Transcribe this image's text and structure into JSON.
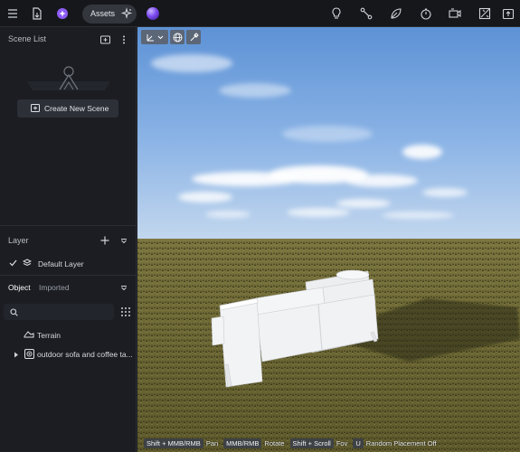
{
  "topbar": {
    "assets_label": "Assets"
  },
  "scene_list": {
    "title": "Scene List",
    "create_button_label": "Create New Scene"
  },
  "layer": {
    "title": "Layer",
    "default_layer_label": "Default Layer"
  },
  "object_panel": {
    "tabs": [
      {
        "label": "Object",
        "active": true
      },
      {
        "label": "Imported",
        "active": false
      }
    ],
    "search_placeholder": "",
    "items": [
      {
        "label": "Terrain",
        "icon": "terrain-icon",
        "expandable": false
      },
      {
        "label": "outdoor sofa and coffee ta...",
        "icon": "model-icon",
        "expandable": true
      }
    ]
  },
  "viewport": {
    "hints": [
      {
        "key": "Shift + MMB/RMB",
        "action": "Pan"
      },
      {
        "key": "MMB/RMB",
        "action": "Rotate"
      },
      {
        "key": "Shift + Scroll",
        "action": "Fov"
      },
      {
        "key": "U",
        "action": "Random Placement Off"
      }
    ]
  },
  "colors": {
    "accent": "#7d4cf0",
    "panel_bg": "#1b1d22",
    "topbar_bg": "#15171b"
  }
}
